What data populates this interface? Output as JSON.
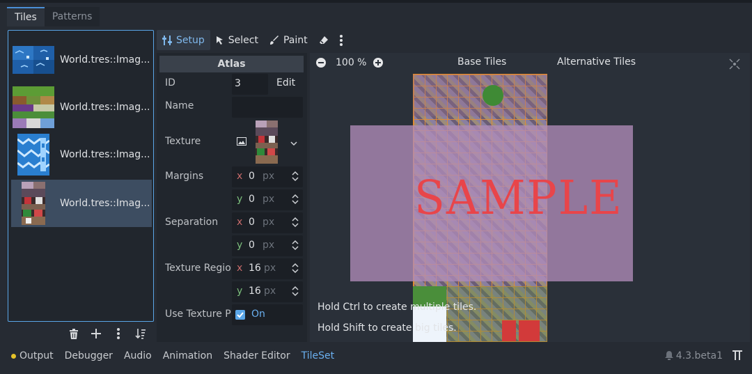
{
  "tabs": [
    "Tiles",
    "Patterns"
  ],
  "sources": [
    {
      "label": "World.tres::Imag...",
      "thumb": "water-tiles"
    },
    {
      "label": "World.tres::Imag...",
      "thumb": "grass-tiles"
    },
    {
      "label": "World.tres::Imag...",
      "thumb": "ice-tiles"
    },
    {
      "label": "World.tres::Imag...",
      "thumb": "objects-tiles"
    }
  ],
  "list_tools": [
    "trash-icon",
    "add-icon",
    "kebab-menu-icon",
    "sort-icon"
  ],
  "modes": {
    "setup": "Setup",
    "select": "Select",
    "paint": "Paint"
  },
  "inspector": {
    "section": "Atlas",
    "id_label": "ID",
    "id_value": "3",
    "edit_label": "Edit",
    "name_label": "Name",
    "texture_label": "Texture",
    "margins_label": "Margins",
    "margins_x": "0",
    "margins_y": "0",
    "separation_label": "Separation",
    "separation_x": "0",
    "separation_y": "0",
    "region_label": "Texture Regio",
    "region_x": "16",
    "region_y": "16",
    "use_padding_label": "Use Texture P",
    "use_padding_value": "On",
    "unit": "px",
    "axis_x": "x",
    "axis_y": "y"
  },
  "viewport": {
    "zoom": "100 %",
    "base_tab": "Base Tiles",
    "alt_tab": "Alternative Tiles",
    "watermark": "SAMPLE",
    "hint_ctrl": "Hold Ctrl to create multiple tiles.",
    "hint_shift": "Hold Shift to create big tiles."
  },
  "bottom": {
    "tabs": [
      "Output",
      "Debugger",
      "Audio",
      "Animation",
      "Shader Editor",
      "TileSet"
    ],
    "version": "4.3.beta1"
  },
  "colors": {
    "accent": "#6ab0f0",
    "selection": "#3d4d61",
    "output_dot": "#e5c229",
    "watermark": "#e8454a"
  }
}
